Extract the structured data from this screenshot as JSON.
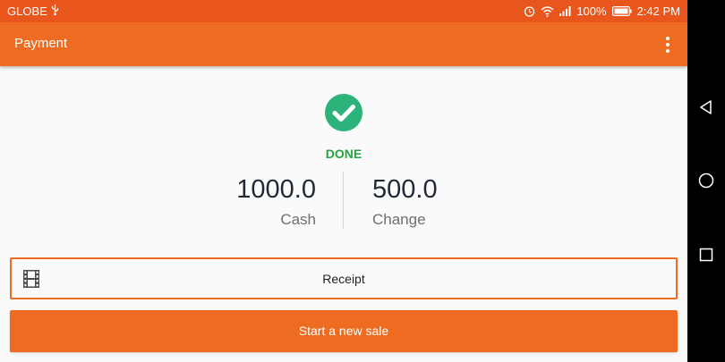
{
  "status_bar": {
    "carrier": "GLOBE",
    "battery": "100%",
    "time": "2:42 PM",
    "icons": [
      "usb-icon",
      "alarm-icon",
      "wifi-icon",
      "signal-icon",
      "battery-icon"
    ]
  },
  "app_bar": {
    "title": "Payment",
    "menu_icon": "more-vert-icon"
  },
  "payment": {
    "status": "DONE",
    "status_color": "#27a243",
    "cash_value": "1000.0",
    "cash_label": "Cash",
    "change_value": "500.0",
    "change_label": "Change"
  },
  "actions": {
    "receipt_label": "Receipt",
    "receipt_icon": "film-icon",
    "new_sale_label": "Start a new sale"
  },
  "colors": {
    "status_bar": "#e9561d",
    "primary": "#ee6c22",
    "success": "#27a243"
  },
  "nav_bar": {
    "icons": [
      "back-icon",
      "home-icon",
      "recents-icon"
    ]
  }
}
